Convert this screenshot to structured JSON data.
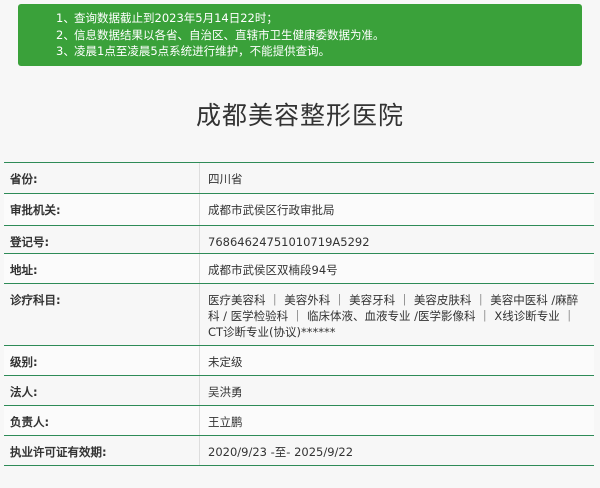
{
  "notice": {
    "lines": [
      {
        "num": "1、",
        "text": "查询数据截止到2023年5月14日22时；"
      },
      {
        "num": "2、",
        "text": "信息数据结果以各省、自治区、直辖市卫生健康委数据为准。"
      },
      {
        "num": "3、",
        "text": "凌晨1点至凌晨5点系统进行维护，不能提供查询。"
      }
    ]
  },
  "title": "成都美容整形医院",
  "table": {
    "rows": [
      {
        "label": "省份:",
        "value": "四川省"
      },
      {
        "label": "审批机关:",
        "value": "成都市武侯区行政审批局"
      },
      {
        "label": "登记号:",
        "value": "76864624751010719A5292"
      },
      {
        "label": "地址:",
        "value": "成都市武侯区双楠段94号"
      },
      {
        "label": "诊疗科目:",
        "value": "医疗美容科 ｜ 美容外科 ｜ 美容牙科 ｜ 美容皮肤科 ｜ 美容中医科 /麻醉科 / 医学检验科 ｜ 临床体液、血液专业 /医学影像科 ｜ X线诊断专业 ｜ CT诊断专业(协议)******"
      },
      {
        "label": "级别:",
        "value": "未定级"
      },
      {
        "label": "法人:",
        "value": "吴洪勇"
      },
      {
        "label": "负责人:",
        "value": "王立鹏"
      },
      {
        "label": "执业许可证有效期:",
        "value": "2020/9/23 -至- 2025/9/22"
      }
    ]
  },
  "colors": {
    "notice_bg": "#3aa13a",
    "border": "#2e8b57"
  }
}
